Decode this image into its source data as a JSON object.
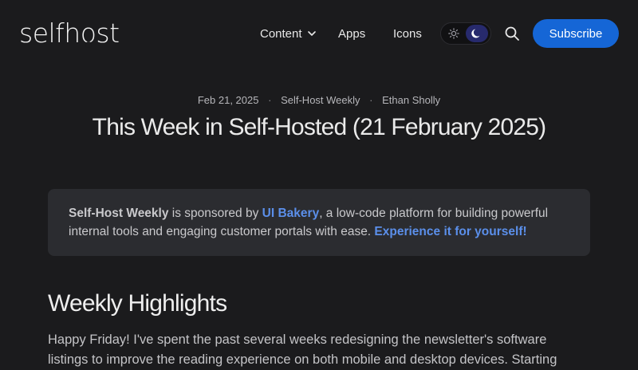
{
  "header": {
    "logo_prefix": "selfh",
    "logo_o": "o",
    "logo_suffix": "st",
    "nav": {
      "content": "Content",
      "apps": "Apps",
      "icons": "Icons"
    },
    "subscribe_label": "Subscribe",
    "theme_mode": "dark"
  },
  "post": {
    "date": "Feb 21, 2025",
    "category": "Self-Host Weekly",
    "author": "Ethan Sholly",
    "separator": "·",
    "title": "This Week in Self-Hosted (21 February 2025)"
  },
  "sponsor": {
    "brand": "Self-Host Weekly",
    "text_1": " is sponsored by ",
    "sponsor_name": "UI Bakery",
    "text_2": ", a low-code platform for building powerful internal tools and engaging customer portals with ease. ",
    "cta": "Experience it for yourself!"
  },
  "section": {
    "heading": "Weekly Highlights",
    "paragraph": "Happy Friday! I've spent the past several weeks redesigning the newsletter's software listings to improve the reading experience on both mobile and desktop devices. Starting"
  },
  "colors": {
    "background": "#1b1b1d",
    "accent": "#1566d6",
    "link": "#5b8fea",
    "sponsor_bg": "#2b2c30"
  }
}
